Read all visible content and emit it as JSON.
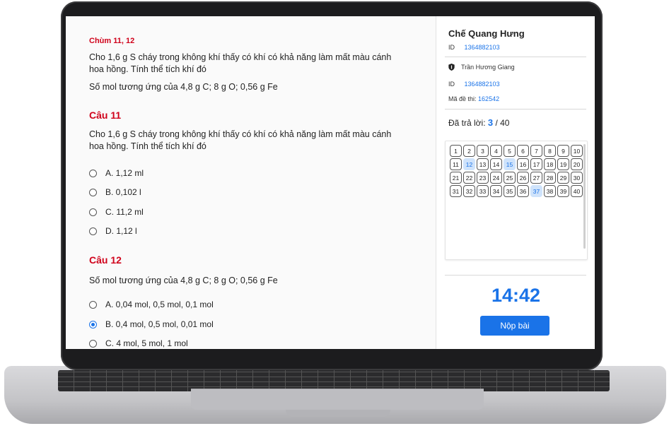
{
  "content": {
    "cluster_label": "Chùm 11, 12",
    "cluster_text_1": "Cho 1,6 g S cháy trong không khí thấy có khí có khả năng làm mất màu cánh hoa hồng. Tính thể tích khí đó",
    "cluster_text_2": "Số mol tương ứng của 4,8 g C; 8 g O; 0,56 g Fe",
    "questions": [
      {
        "title": "Câu 11",
        "text": "Cho 1,6 g S cháy trong không khí thấy có khí có khả năng làm mất màu cánh hoa hồng. Tính thể tích khí đó",
        "options": [
          "A. 1,12 ml",
          "B. 0,102 l",
          "C. 11,2 ml",
          "D. 1,12 l"
        ],
        "selected": null
      },
      {
        "title": "Câu 12",
        "text": "Số mol tương ứng của 4,8 g C; 8 g O; 0,56 g Fe",
        "options": [
          "A. 0,04 mol, 0,5 mol, 0,1 mol",
          "B. 0,4 mol, 0,5 mol, 0,01 mol",
          "C. 4 mol, 5 mol, 1 mol"
        ],
        "selected": 1
      }
    ]
  },
  "sidebar": {
    "student_name": "Chế Quang Hưng",
    "id_label": "ID",
    "student_id": "1364882103",
    "proctor_icon": "shield-icon",
    "proctor_name": "Trần Hương Giang",
    "proctor_id_label": "ID",
    "proctor_id": "1364882103",
    "exam_code_label": "Mã đề thi:",
    "exam_code": "162542",
    "answered_label": "Đã trả lời:",
    "answered_count": "3",
    "answered_total": "/ 40",
    "questions": [
      "1",
      "2",
      "3",
      "4",
      "5",
      "6",
      "7",
      "8",
      "9",
      "10",
      "11",
      "12",
      "13",
      "14",
      "15",
      "16",
      "17",
      "18",
      "19",
      "20",
      "21",
      "22",
      "23",
      "24",
      "25",
      "26",
      "27",
      "28",
      "29",
      "30",
      "31",
      "32",
      "33",
      "34",
      "35",
      "36",
      "37",
      "38",
      "39",
      "40"
    ],
    "answered_questions": [
      "12",
      "15",
      "37"
    ],
    "timer": "14:42",
    "submit_label": "Nộp bài"
  },
  "colors": {
    "accent": "#1a73e8",
    "heading_red": "#d0021b",
    "answered_bg": "#cfe3fb"
  }
}
